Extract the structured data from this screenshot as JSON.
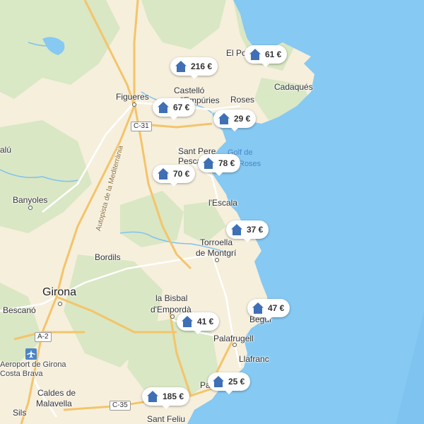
{
  "map": {
    "towns": {
      "el_port": "El Port",
      "cadaques": "Cadaqués",
      "castello": "Castelló",
      "empuries": "d'Empúries",
      "figueres": "Figueres",
      "roses": "Roses",
      "salu": "alú",
      "sant_pere": "Sant Pere",
      "pescador": "Pescador",
      "golf1": "Golf de",
      "golf2": "Roses",
      "banyoles": "Banyoles",
      "autopista": "Autopista de la Mediterrània",
      "lescala": "l'Escala",
      "torroella": "Torroella",
      "montgri": "de Montgrí",
      "bordils": "Bordils",
      "girona": "Girona",
      "bescano": "Bescanó",
      "bisbal": "la Bisbal",
      "emporda": "d'Empordà",
      "begur": "Begur",
      "palafrugell": "Palafrugell",
      "llafranc": "Llafranc",
      "aeroport1": "Aeroport de Girona",
      "aeroport2": "Costa Brava",
      "caldes": "Caldes de",
      "malavella": "Malavella",
      "sils": "Sils",
      "sant_feliu": "Sant Feliu",
      "palamos": "Pa"
    },
    "roads": {
      "c31": "C-31",
      "a2": "A-2",
      "c35": "C-35"
    }
  },
  "markers": [
    {
      "price": "216 €"
    },
    {
      "price": "61 €"
    },
    {
      "price": "67 €"
    },
    {
      "price": "29 €"
    },
    {
      "price": "70 €"
    },
    {
      "price": "78 €"
    },
    {
      "price": "37 €"
    },
    {
      "price": "47 €"
    },
    {
      "price": "41 €"
    },
    {
      "price": "25 €"
    },
    {
      "price": "185 €"
    }
  ],
  "colors": {
    "sea": "#86c9f2",
    "land": "#f6efdc",
    "green": "#d8e8c4",
    "marker_icon": "#3f6fb5"
  }
}
